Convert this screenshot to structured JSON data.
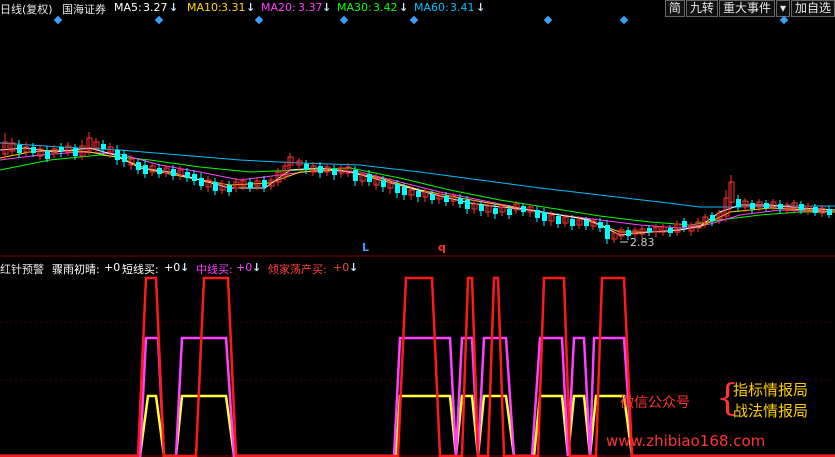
{
  "header": {
    "period": "日线(复权)",
    "stock": "国海证券",
    "ma5_label": "MA5:",
    "ma5_value": "3.27",
    "ma10_label": "MA10:",
    "ma10_value": "3.31",
    "ma20_label": "MA20:",
    "ma20_value": "3.37",
    "ma30_label": "MA30:",
    "ma30_value": "3.42",
    "ma60_label": "MA60:",
    "ma60_value": "3.41",
    "arrow": "↓"
  },
  "colors": {
    "ma5": "#ffffff",
    "ma10": "#ffd700",
    "ma20": "#ff40ff",
    "ma30": "#00ff00",
    "ma60": "#00bfff",
    "up": "#ff3030",
    "down": "#00ffff",
    "bg": "#000000"
  },
  "toolbar": {
    "btn_jian": "简",
    "btn_jiuzhuan": "九转",
    "btn_events": "重大事件",
    "btn_dropdown": "▾",
    "btn_add": "加自选"
  },
  "chart": {
    "low_label": "2.83",
    "marker_L": "L",
    "marker_q": "q"
  },
  "indicator": {
    "title": "红针预警",
    "item1_label": "骤雨初晴:",
    "item1_value": "+0",
    "item2_label": "短线买:",
    "item2_value": "+0",
    "item3_label": "中线买:",
    "item3_value": "+0",
    "item4_label": "倾家荡产买:",
    "item4_value": "+0",
    "arrow": "↓"
  },
  "watermark": {
    "wechat": "微信公众号",
    "line1": "指标情报局",
    "line2": "战法情报局",
    "url": "www.zhibiao168.com"
  }
}
